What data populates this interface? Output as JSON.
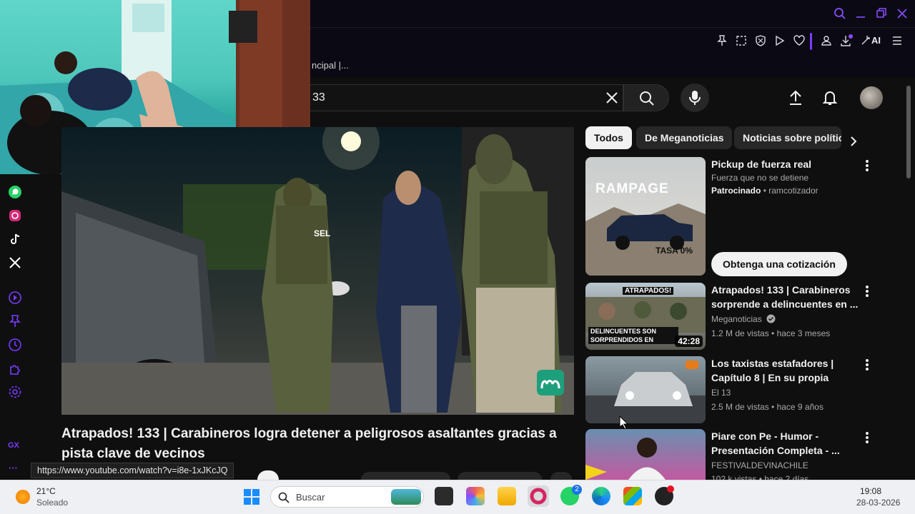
{
  "browser": {
    "tab_title": "ncipal |...",
    "toolbar_icons": [
      "pin-icon",
      "snapshot-icon",
      "shield-icon",
      "play-icon",
      "heart-icon",
      "profile-icon",
      "download-icon",
      "ai-icon",
      "menu-icon"
    ],
    "ai_label": "AI",
    "window_controls": [
      "search-icon",
      "minimize-icon",
      "restore-icon",
      "close-icon"
    ]
  },
  "search": {
    "query": "33"
  },
  "sidebar": {
    "icons": [
      "whatsapp-icon",
      "instagram-icon",
      "tiktok-icon",
      "x-icon",
      "player-icon",
      "pin-icon",
      "history-icon",
      "extensions-icon",
      "settings-icon"
    ],
    "gx_label": "GX",
    "more_label": "···"
  },
  "video": {
    "title": "Atrapados! 133 | Carabineros logra detener a peligrosos asaltantes gracias a pista clave de vecinos",
    "hover_url": "https://www.youtube.com/watch?v=i8e-1xJKcJQ",
    "vest_label": "SEL"
  },
  "chips": [
    "Todos",
    "De Meganoticias",
    "Noticias sobre polític"
  ],
  "recommendations": [
    {
      "title": "Pickup de fuerza real",
      "subtitle": "Fuerza que no se detiene",
      "sponsored": "Patrocinado",
      "advertiser": "ramcotizador",
      "cta": "Obtenga una cotización",
      "thumb_brand": "RAMPAGE",
      "thumb_offer": "TASA 0%"
    },
    {
      "title": "Atrapados! 133 | Carabineros sorprende a delincuentes en ...",
      "channel": "Meganoticias",
      "verified": true,
      "stats": "1.2 M de vistas • hace 3 meses",
      "duration": "42:28",
      "thumb_top": "ATRAPADOS!",
      "thumb_bottom": "DELINCUENTES SON SORPRENDIDOS EN FLAGR"
    },
    {
      "title": "Los taxistas estafadores | Capítulo 8 | En su propia tramp...",
      "channel": "El 13",
      "stats": "2.5 M de vistas • hace 9 años"
    },
    {
      "title": "Piare con Pe - Humor - Presentación Completa - ...",
      "channel": "FESTIVALDEVINACHILE",
      "stats": "102 k vistas • hace 2 días"
    }
  ],
  "taskbar": {
    "weather_temp": "21°C",
    "weather_desc": "Soleado",
    "search_placeholder": "Buscar",
    "whatsapp_badge": "2",
    "time": "19:08",
    "date": "28-03-2026"
  },
  "colors": {
    "background": "#0f0f0f",
    "chrome": "#0b0a14",
    "accent_purple": "#7a3cff",
    "chip_active": "#f1f1f1",
    "chip_inactive": "#272727"
  }
}
